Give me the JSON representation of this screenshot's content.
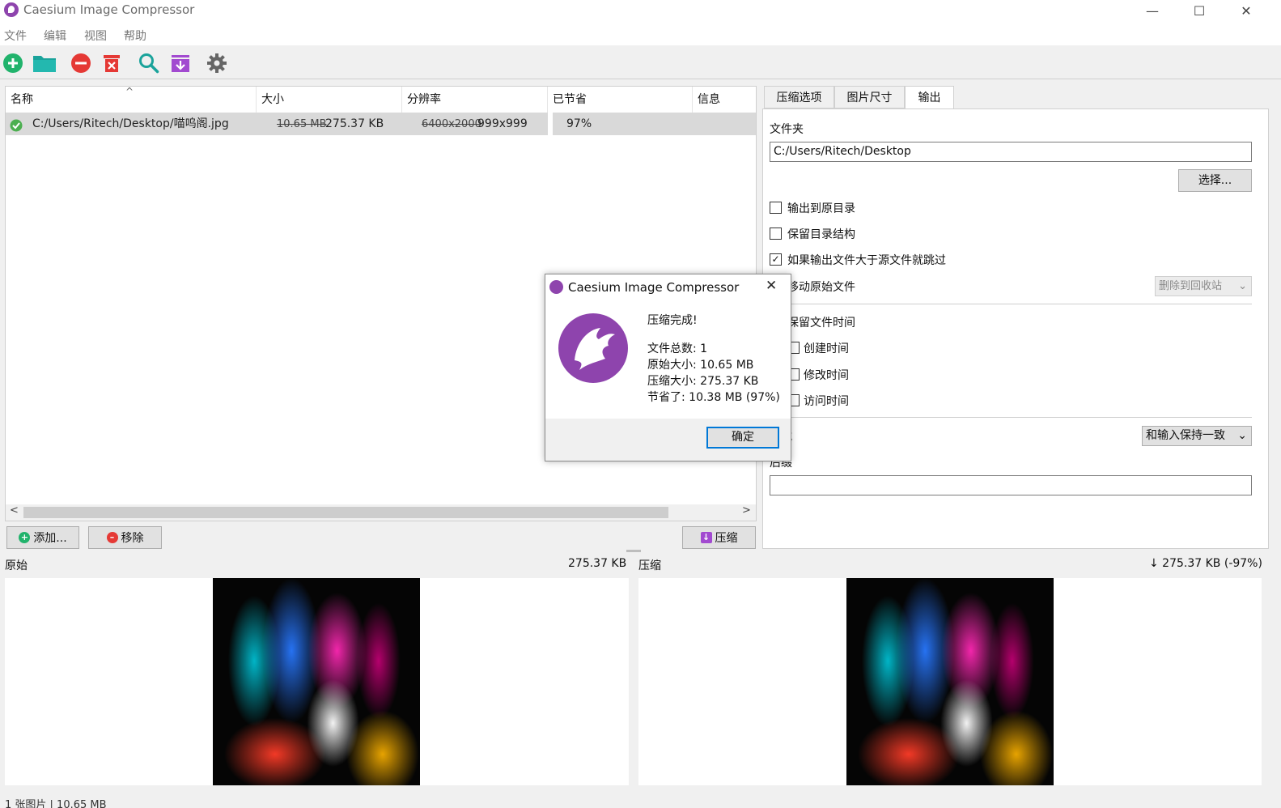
{
  "window": {
    "title": "Caesium Image Compressor",
    "minimize": "—",
    "maximize": "☐",
    "close": "✕"
  },
  "menu": [
    "文件",
    "编辑",
    "视图",
    "帮助"
  ],
  "toolbar": {
    "icons": [
      "add-icon",
      "folder-icon",
      "remove-icon",
      "clear-icon",
      "search-icon",
      "export-icon",
      "settings-icon"
    ]
  },
  "table": {
    "columns": [
      "名称",
      "大小",
      "分辨率",
      "已节省",
      "信息"
    ],
    "rows": [
      {
        "name": "C:/Users/Ritech/Desktop/喵呜阁.jpg",
        "size_original": "10.65 MB",
        "size_new": "275.37 KB",
        "res_original": "6400x2000",
        "res_new": "999x999",
        "saved": "97%",
        "info": ""
      }
    ]
  },
  "buttons": {
    "add": "添加...",
    "remove": "移除",
    "compress": "压缩"
  },
  "tabs": [
    "压缩选项",
    "图片尺寸",
    "输出"
  ],
  "output": {
    "folder_label": "文件夹",
    "folder_value": "C:/Users/Ritech/Desktop",
    "choose_button": "选择...",
    "same_folder": "输出到原目录",
    "keep_structure": "保留目录结构",
    "skip_larger": "如果输出文件大于源文件就跳过",
    "move_original": "移动原始文件",
    "move_option": "删除到回收站",
    "keep_dates": "保留文件时间",
    "creation": "创建时间",
    "modified": "修改时间",
    "accessed": "访问时间",
    "format_label": "格式",
    "format_value": "和输入保持一致",
    "suffix_label": "后缀",
    "suffix_value": ""
  },
  "preview": {
    "original_label": "原始",
    "original_size": "275.37 KB",
    "compressed_label": "压缩",
    "compressed_size": "↓ 275.37 KB (-97%)"
  },
  "statusbar": {
    "text": "1 张图片 | 10.65 MB"
  },
  "dialog": {
    "title": "Caesium Image Compressor",
    "heading": "压缩完成!",
    "total_files": "文件总数: 1",
    "original_size": "原始大小: 10.65 MB",
    "compressed_size": "压缩大小: 275.37 KB",
    "saved": "节省了: 10.38 MB (97%)",
    "ok": "确定"
  },
  "colors": {
    "accent_purple": "#8e44ad",
    "add_green": "#21b36c",
    "remove_red": "#e53935",
    "folder_teal": "#1aa39b"
  }
}
